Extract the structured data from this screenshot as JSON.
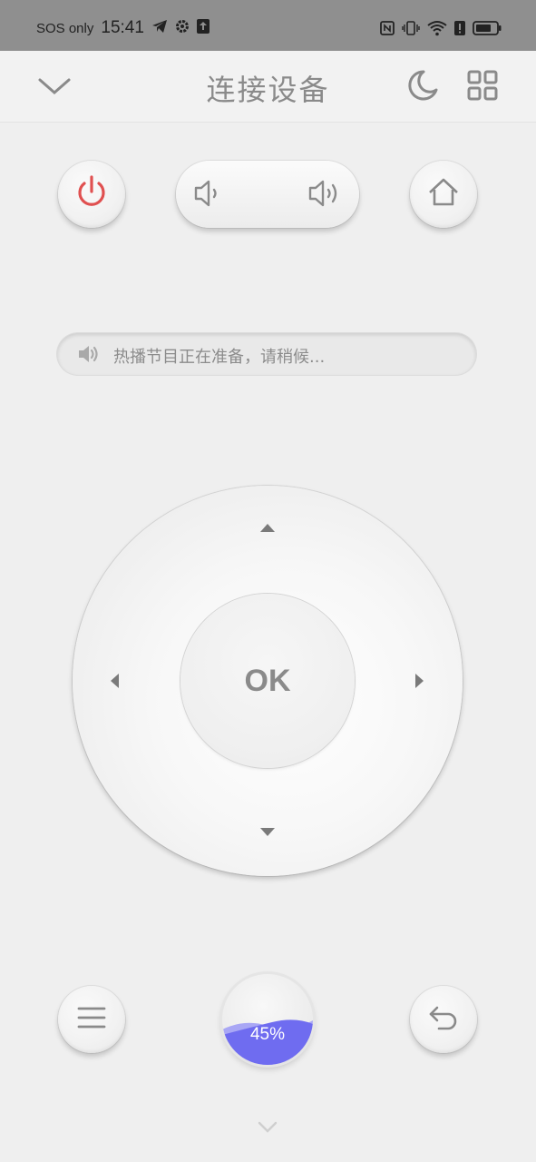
{
  "status_bar": {
    "carrier": "SOS only",
    "time": "15:41",
    "icons": [
      "telegram-icon",
      "gear-icon",
      "upload-icon",
      "nfc-icon",
      "vibrate-icon",
      "wifi-icon",
      "alert-icon",
      "battery-icon"
    ]
  },
  "header": {
    "title": "连接设备",
    "icons": [
      "chevron-down-icon",
      "moon-icon",
      "grid-icon"
    ]
  },
  "controls": {
    "power_icon": "power-icon",
    "volume_down_icon": "volume-down-icon",
    "volume_up_icon": "volume-up-icon",
    "home_icon": "home-icon"
  },
  "notice": {
    "icon": "speaker-icon",
    "text": "热播节目正在准备，请稍候..."
  },
  "dpad": {
    "ok_label": "OK"
  },
  "bottom": {
    "menu_icon": "menu-icon",
    "back_icon": "back-icon",
    "level_label": "45%",
    "level": 0.45,
    "more_icon": "chevron-down-icon"
  },
  "colors": {
    "power": "#e05050",
    "wave": "#6f6cf0",
    "wave_light": "#a9a7f5"
  }
}
